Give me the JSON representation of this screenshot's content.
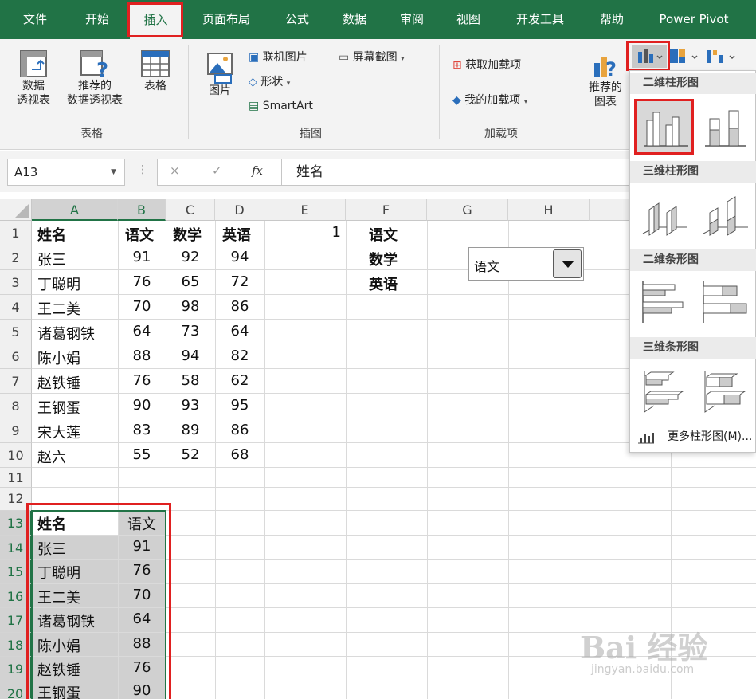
{
  "tabs": [
    "文件",
    "开始",
    "插入",
    "页面布局",
    "公式",
    "数据",
    "审阅",
    "视图",
    "开发工具",
    "帮助",
    "Power Pivot"
  ],
  "ribbon": {
    "pivot_label_1": "数据",
    "pivot_label_2": "透视表",
    "rec_pivot_1": "推荐的",
    "rec_pivot_2": "数据透视表",
    "table_label": "表格",
    "group_tables": "表格",
    "picture_label": "图片",
    "online_picture": "联机图片",
    "shapes": "形状",
    "screenshot": "屏幕截图",
    "smartart": "SmartArt",
    "group_illustrations": "插图",
    "get_addins": "获取加载项",
    "my_addins": "我的加载项",
    "group_addins": "加载项",
    "rec_charts_1": "推荐的",
    "rec_charts_2": "图表"
  },
  "formula_bar": {
    "name_box": "A13",
    "cancel": "×",
    "enter": "✓",
    "fx": "fx",
    "value": "姓名"
  },
  "columns": [
    "A",
    "B",
    "C",
    "D",
    "E",
    "F",
    "G",
    "H"
  ],
  "rows": [
    "1",
    "2",
    "3",
    "4",
    "5",
    "6",
    "7",
    "8",
    "9",
    "10",
    "11",
    "12",
    "13",
    "14",
    "15",
    "16",
    "17",
    "18",
    "19",
    "20"
  ],
  "sheet": {
    "headers": [
      "姓名",
      "语文",
      "数学",
      "英语"
    ],
    "e1": "1",
    "f_list": [
      "语文",
      "数学",
      "英语"
    ],
    "students": [
      {
        "name": "张三",
        "chinese": "91",
        "math": "92",
        "english": "94"
      },
      {
        "name": "丁聪明",
        "chinese": "76",
        "math": "65",
        "english": "72"
      },
      {
        "name": "王二美",
        "chinese": "70",
        "math": "98",
        "english": "86"
      },
      {
        "name": "诸葛钢铁",
        "chinese": "64",
        "math": "73",
        "english": "64"
      },
      {
        "name": "陈小娟",
        "chinese": "88",
        "math": "94",
        "english": "82"
      },
      {
        "name": "赵铁锤",
        "chinese": "76",
        "math": "58",
        "english": "62"
      },
      {
        "name": "王钢蛋",
        "chinese": "90",
        "math": "93",
        "english": "95"
      },
      {
        "name": "宋大莲",
        "chinese": "83",
        "math": "89",
        "english": "86"
      },
      {
        "name": "赵六",
        "chinese": "55",
        "math": "52",
        "english": "68"
      }
    ],
    "sub_headers": [
      "姓名",
      "语文"
    ],
    "sub_rows": [
      {
        "name": "张三",
        "score": "91"
      },
      {
        "name": "丁聪明",
        "score": "76"
      },
      {
        "name": "王二美",
        "score": "70"
      },
      {
        "name": "诸葛钢铁",
        "score": "64"
      },
      {
        "name": "陈小娟",
        "score": "88"
      },
      {
        "name": "赵铁锤",
        "score": "76"
      },
      {
        "name": "王钢蛋",
        "score": "90"
      }
    ]
  },
  "combo": {
    "value": "语文"
  },
  "chart_menu": {
    "h_2d_column": "二维柱形图",
    "h_3d_column": "三维柱形图",
    "h_2d_bar": "二维条形图",
    "h_3d_bar": "三维条形图",
    "more": "更多柱形图(M)..."
  },
  "watermark": {
    "main": "Bai 经验",
    "sub": "jingyan.baidu.com"
  },
  "colors": {
    "excel_green": "#217346",
    "highlight_red": "#e02020"
  }
}
